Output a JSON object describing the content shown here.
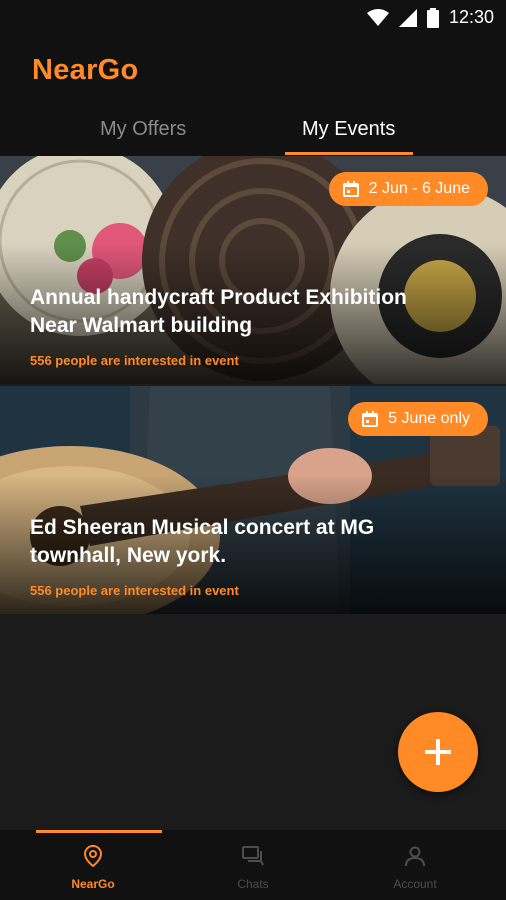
{
  "status_bar": {
    "time": "12:30",
    "icons": [
      "wifi-icon",
      "signal-icon",
      "battery-icon"
    ]
  },
  "app": {
    "title": "NearGo",
    "accent_color": "#ff8a26"
  },
  "tabs": [
    {
      "label": "My Offers",
      "active": false
    },
    {
      "label": "My Events",
      "active": true
    }
  ],
  "events": [
    {
      "date": "2 Jun - 6 June",
      "title_line1": "Annual handycraft Product Exhibition",
      "title_line2": "Near Walmart building",
      "interest": "556 people are interested in event"
    },
    {
      "date": "5 June only",
      "title_line1": "Ed Sheeran Musical concert at MG",
      "title_line2": "townhall, New york.",
      "interest": "556 people are interested in event"
    }
  ],
  "fab": {
    "icon": "plus-icon"
  },
  "bottom_nav": [
    {
      "label": "NearGo",
      "icon": "location-pin-icon",
      "active": true
    },
    {
      "label": "Chats",
      "icon": "chat-icon",
      "active": false
    },
    {
      "label": "Account",
      "icon": "person-icon",
      "active": false
    }
  ]
}
